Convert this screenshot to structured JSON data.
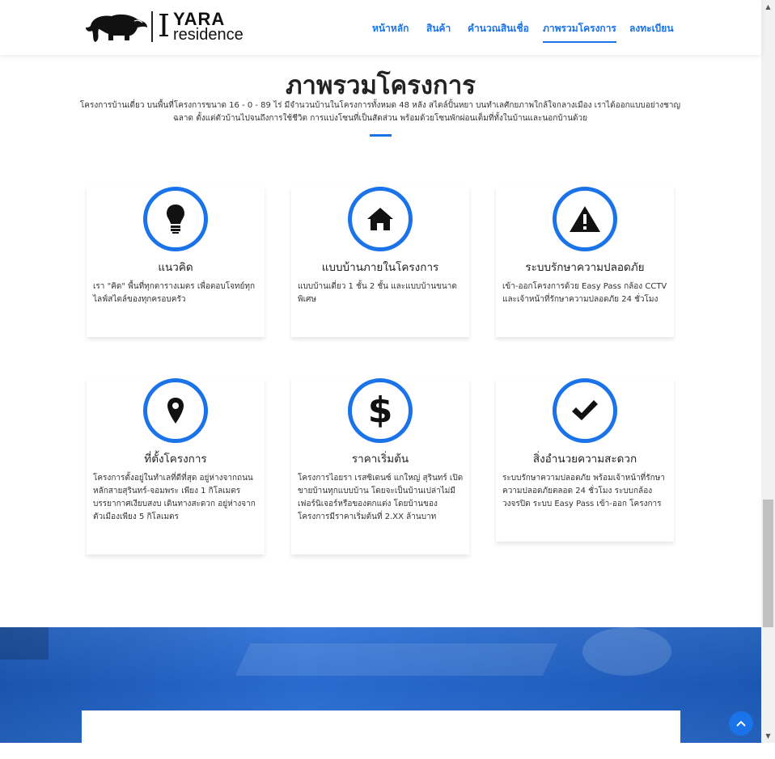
{
  "brand": {
    "mark": "I",
    "name_top": "YARA",
    "name_bottom": "residence"
  },
  "nav": [
    {
      "label": "หน้าหลัก",
      "active": false
    },
    {
      "label": "สินค้า",
      "active": false
    },
    {
      "label": "คำนวณสินเชื่อ",
      "active": false
    },
    {
      "label": "ภาพรวมโครงการ",
      "active": true
    },
    {
      "label": "ลงทะเบียน",
      "active": false
    }
  ],
  "section": {
    "title": "ภาพรวมโครงการ",
    "description": "โครงการบ้านเดี่ยว บนพื้นที่โครงการขนาด 16 - 0 - 89 ไร่ มีจำนวนบ้านในโครงการทั้งหมด 48 หลัง สไตล์ปั้นหยา บนทำเลศักยภาพใกล้ใจกลางเมือง เราได้ออกแบบอย่างชาญฉลาด ตั้งแต่ตัวบ้านไปจนถึงการใช้ชีวิต การแบ่งโซนที่เป็นสัดส่วน พร้อมด้วยโซนพักผ่อนเต็มที่ทั้งในบ้านและนอกบ้านด้วย"
  },
  "features": [
    {
      "icon": "lightbulb-icon",
      "title": "แนวคิด",
      "text": "เรา \"คิด\" พื้นที่ทุกตารางเมตร เพื่อตอบโจทย์ทุกไลฟ์สไตล์ของทุกครอบครัว"
    },
    {
      "icon": "home-icon",
      "title": "แบบบ้านภายในโครงการ",
      "text": "แบบบ้านเดี่ยว 1 ชั้น 2 ชั้น และแบบบ้านขนาดพิเศษ"
    },
    {
      "icon": "warning-icon",
      "title": "ระบบรักษาความปลอดภัย",
      "text": "เข้า-ออกโครงการด้วย Easy Pass กล้อง CCTV และเจ้าหน้าที่รักษาความปลอดภัย 24 ชั่วโมง"
    },
    {
      "icon": "map-marker-icon",
      "title": "ที่ตั้งโครงการ",
      "text": "โครงการตั้งอยู่ในทำเลที่ดีที่สุด อยู่ห่างจากถนนหลักสายสุรินทร์-จอมพระ เพียง 1 กิโลเมตร บรรยากาศเงียบสงบ เดินทางสะดวก อยู่ห่างจากตัวเมืองเพียง 5 กิโลเมตร"
    },
    {
      "icon": "dollar-icon",
      "title": "ราคาเริ่มต้น",
      "text": "โครงการไอยรา เรสซิเดนซ์ แกใหญ่ สุรินทร์ เปิดขายบ้านทุกแบบบ้าน โดยจะเป็นบ้านเปล่าไม่มีเฟอร์นิเจอร์หรือของตกแต่ง โดยบ้านของโครงการมีราคาเริ่มต้นที่ 2.XX ล้านบาท"
    },
    {
      "icon": "checkmark-icon",
      "title": "สิ่งอำนวยความสะดวก",
      "text": "ระบบรักษาความปลอดภัย พร้อมเจ้าหน้าที่รักษาความปลอดภัยตลอด 24 ชั่วโมง ระบบกล้องวงจรปิด ระบบ Easy Pass เข้า-ออก โครงการ"
    }
  ],
  "colors": {
    "accent": "#1a73e8",
    "banner": "#2a6fd4"
  }
}
